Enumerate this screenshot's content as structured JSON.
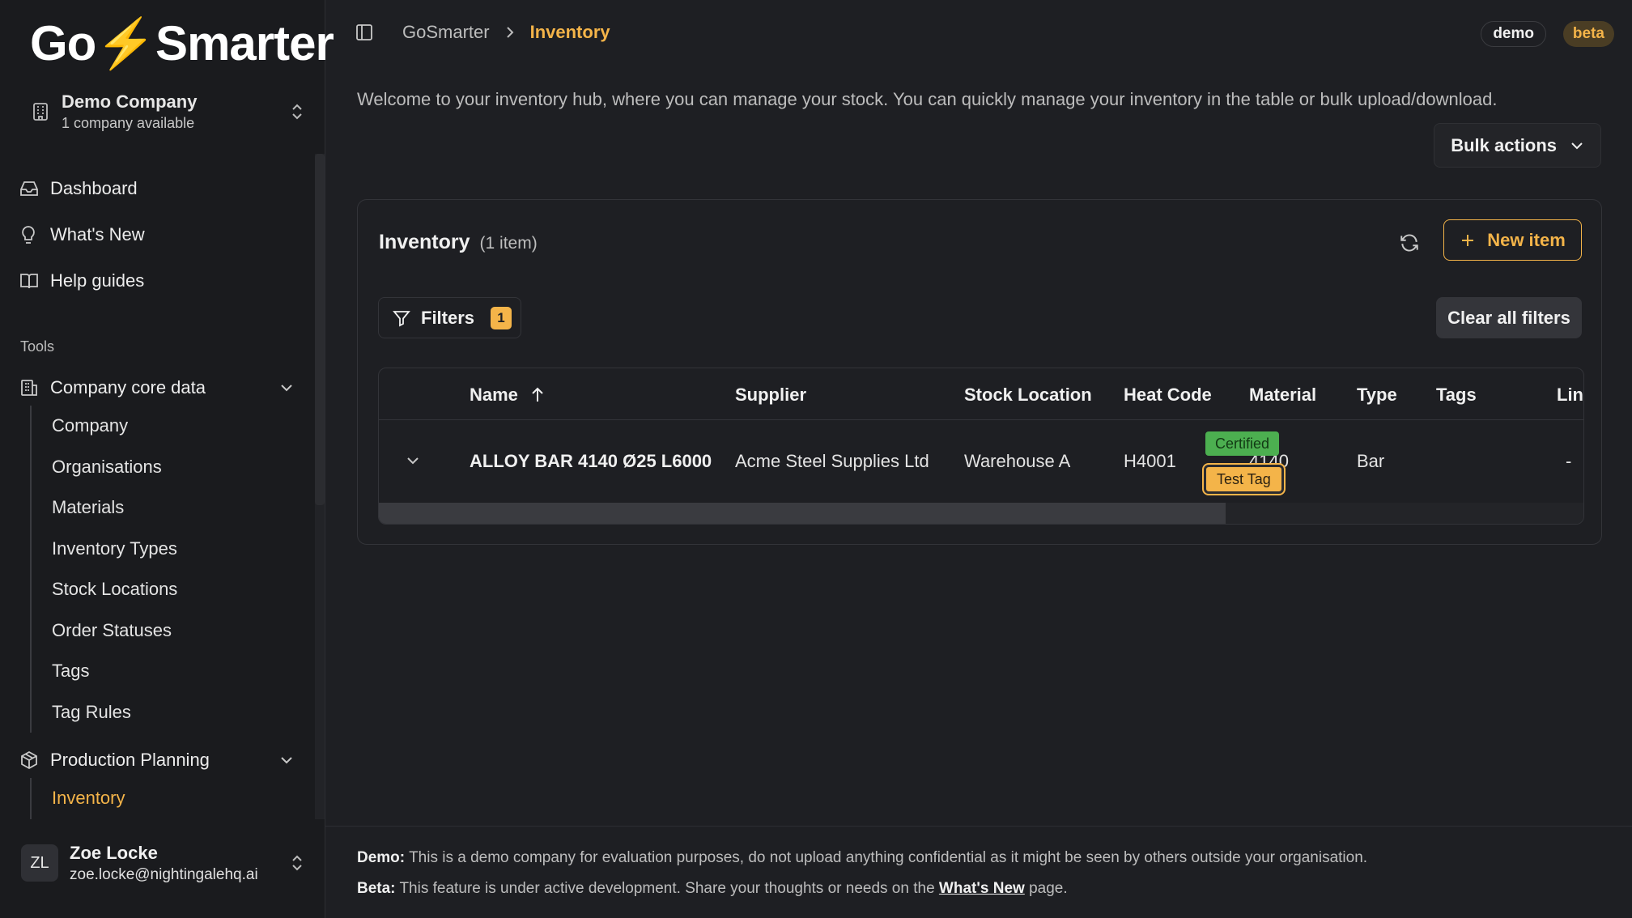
{
  "brand": {
    "logo_left": "Go",
    "logo_bolt": "⚡",
    "logo_right": "Smarter"
  },
  "company": {
    "name": "Demo Company",
    "subtitle": "1 company available"
  },
  "nav": {
    "top_items": [
      {
        "label": "Dashboard",
        "icon": "inbox-icon"
      },
      {
        "label": "What's New",
        "icon": "lightbulb-icon"
      },
      {
        "label": "Help guides",
        "icon": "book-icon"
      }
    ],
    "tools_label": "Tools",
    "groups": [
      {
        "label": "Company core data",
        "icon": "building-icon",
        "items": [
          "Company",
          "Organisations",
          "Materials",
          "Inventory Types",
          "Stock Locations",
          "Order Statuses",
          "Tags",
          "Tag Rules"
        ]
      },
      {
        "label": "Production Planning",
        "icon": "box-icon",
        "items": [
          "Inventory"
        ]
      }
    ],
    "active_item": "Inventory"
  },
  "user": {
    "initials": "ZL",
    "name": "Zoe Locke",
    "email": "zoe.locke@nightingalehq.ai"
  },
  "breadcrumb": {
    "root": "GoSmarter",
    "current": "Inventory"
  },
  "badges": {
    "demo": "demo",
    "beta": "beta"
  },
  "welcome_text": "Welcome to your inventory hub, where you can manage your stock. You can quickly manage your inventory in the table or bulk upload/download.",
  "bulk_actions_label": "Bulk actions",
  "card": {
    "title": "Inventory",
    "count": "(1 item)",
    "new_item_label": "New item",
    "filters_label": "Filters",
    "filters_count": "1",
    "clear_filters_label": "Clear all filters"
  },
  "table": {
    "columns": [
      "Name",
      "Supplier",
      "Stock Location",
      "Heat Code",
      "Material",
      "Type",
      "Tags",
      "Lin"
    ],
    "rows": [
      {
        "name": "ALLOY BAR 4140 Ø25 L6000",
        "supplier": "Acme Steel Supplies Ltd",
        "stock_location": "Warehouse A",
        "heat_code": "H4001",
        "material": "4140",
        "type": "Bar",
        "tags": [
          "Certified",
          "Test Tag"
        ],
        "lin": "-"
      }
    ]
  },
  "footer": {
    "demo_label": "Demo:",
    "demo_text": "This is a demo company for evaluation purposes, do not upload anything confidential as it might be seen by others outside your organisation.",
    "beta_label": "Beta:",
    "beta_text_before": "This feature is under active development. Share your thoughts or needs on the",
    "beta_link": "What's New",
    "beta_text_after": "page."
  },
  "colors": {
    "accent": "#f4b449",
    "certified": "#4caf50",
    "background": "#1e1f23",
    "sidebar": "#1a1b1e"
  }
}
